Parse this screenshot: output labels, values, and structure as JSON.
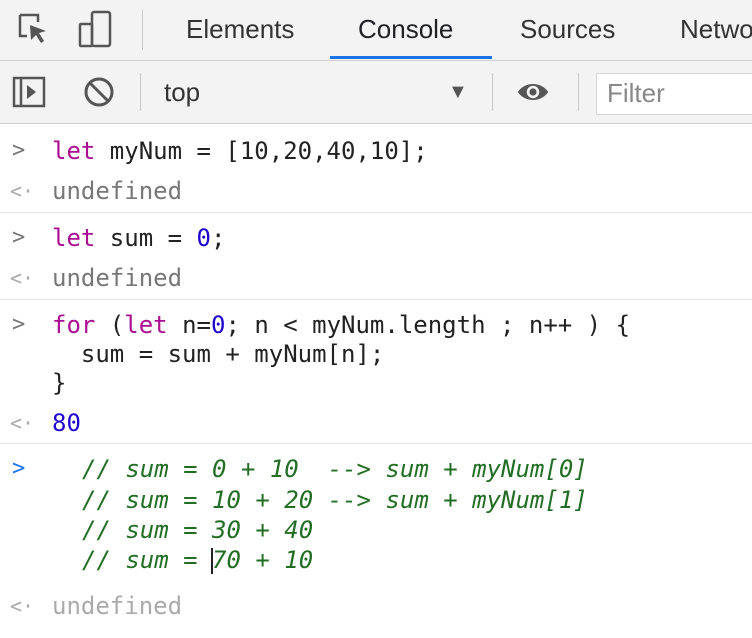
{
  "tabs": [
    "Elements",
    "Console",
    "Sources",
    "Netwo"
  ],
  "toolbar": {
    "context": "top",
    "filter_placeholder": "Filter"
  },
  "console": {
    "entry1": {
      "code": [
        "let",
        " myNum = [10,20,40,10];"
      ],
      "result": "undefined"
    },
    "entry2": {
      "code": [
        "let",
        " sum = ",
        "0",
        ";"
      ],
      "result": "undefined"
    },
    "entry3": {
      "line1": [
        "for",
        " (",
        "let",
        " n=",
        "0",
        "; n < myNum.length ; n++ ) {"
      ],
      "line2": "  sum = sum + myNum[n];",
      "line3": "}",
      "result": "80"
    },
    "entry4": {
      "lines": [
        "// sum = 0 + 10  --> sum + myNum[0]",
        "// sum = 10 + 20 --> sum + myNum[1]",
        "// sum = 30 + 40",
        "// sum = ",
        "70 + 10"
      ],
      "result": "undefined"
    }
  },
  "icons": [
    "inspect-icon",
    "device-toolbar-icon",
    "sidebar-toggle-icon",
    "clear-console-icon",
    "dropdown-arrow-icon",
    "eye-icon",
    "prompt-icon",
    "result-icon"
  ],
  "colors": {
    "keyword": "#aa0d91",
    "number": "#1c00cf",
    "comment": "#236e25",
    "accent": "#1a73e8"
  }
}
